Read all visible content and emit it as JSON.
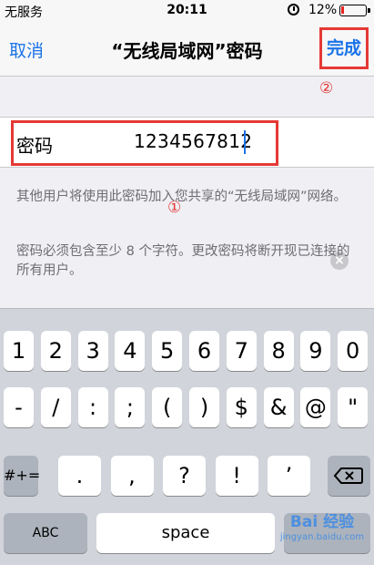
{
  "status_bar": {
    "carrier": "无服务",
    "time": "20:11",
    "battery_percent": "12%",
    "battery_level": 0.12,
    "alarm_icon": "alarm-clock-icon"
  },
  "nav": {
    "cancel": "取消",
    "title": "“无线局域网”密码",
    "done": "完成"
  },
  "annotations": {
    "marker_1": "①",
    "marker_2": "②"
  },
  "password": {
    "label": "密码",
    "value": "1234567812",
    "clear_icon": "clear-circle-icon"
  },
  "footnotes": {
    "share": "其他用户将使用此密码加入您共享的“无线局域网”网络。",
    "requirement": "密码必须包含至少 8 个字符。更改密码将断开现已连接的所有用户。"
  },
  "keyboard": {
    "row1": [
      "1",
      "2",
      "3",
      "4",
      "5",
      "6",
      "7",
      "8",
      "9",
      "0"
    ],
    "row2": [
      "-",
      "/",
      ":",
      ";",
      "(",
      ")",
      "$",
      "&",
      "@",
      "\""
    ],
    "row3_toggle": "#+=",
    "row3": [
      ".",
      ",",
      "?",
      "!",
      "’"
    ],
    "backspace_icon": "backspace-icon",
    "abc": "ABC",
    "space": "space"
  },
  "watermark": {
    "brand": "Bai 经验",
    "url": "jingyan.baidu.com"
  },
  "colors": {
    "accent": "#1a73e8",
    "annotation": "#e53935"
  }
}
